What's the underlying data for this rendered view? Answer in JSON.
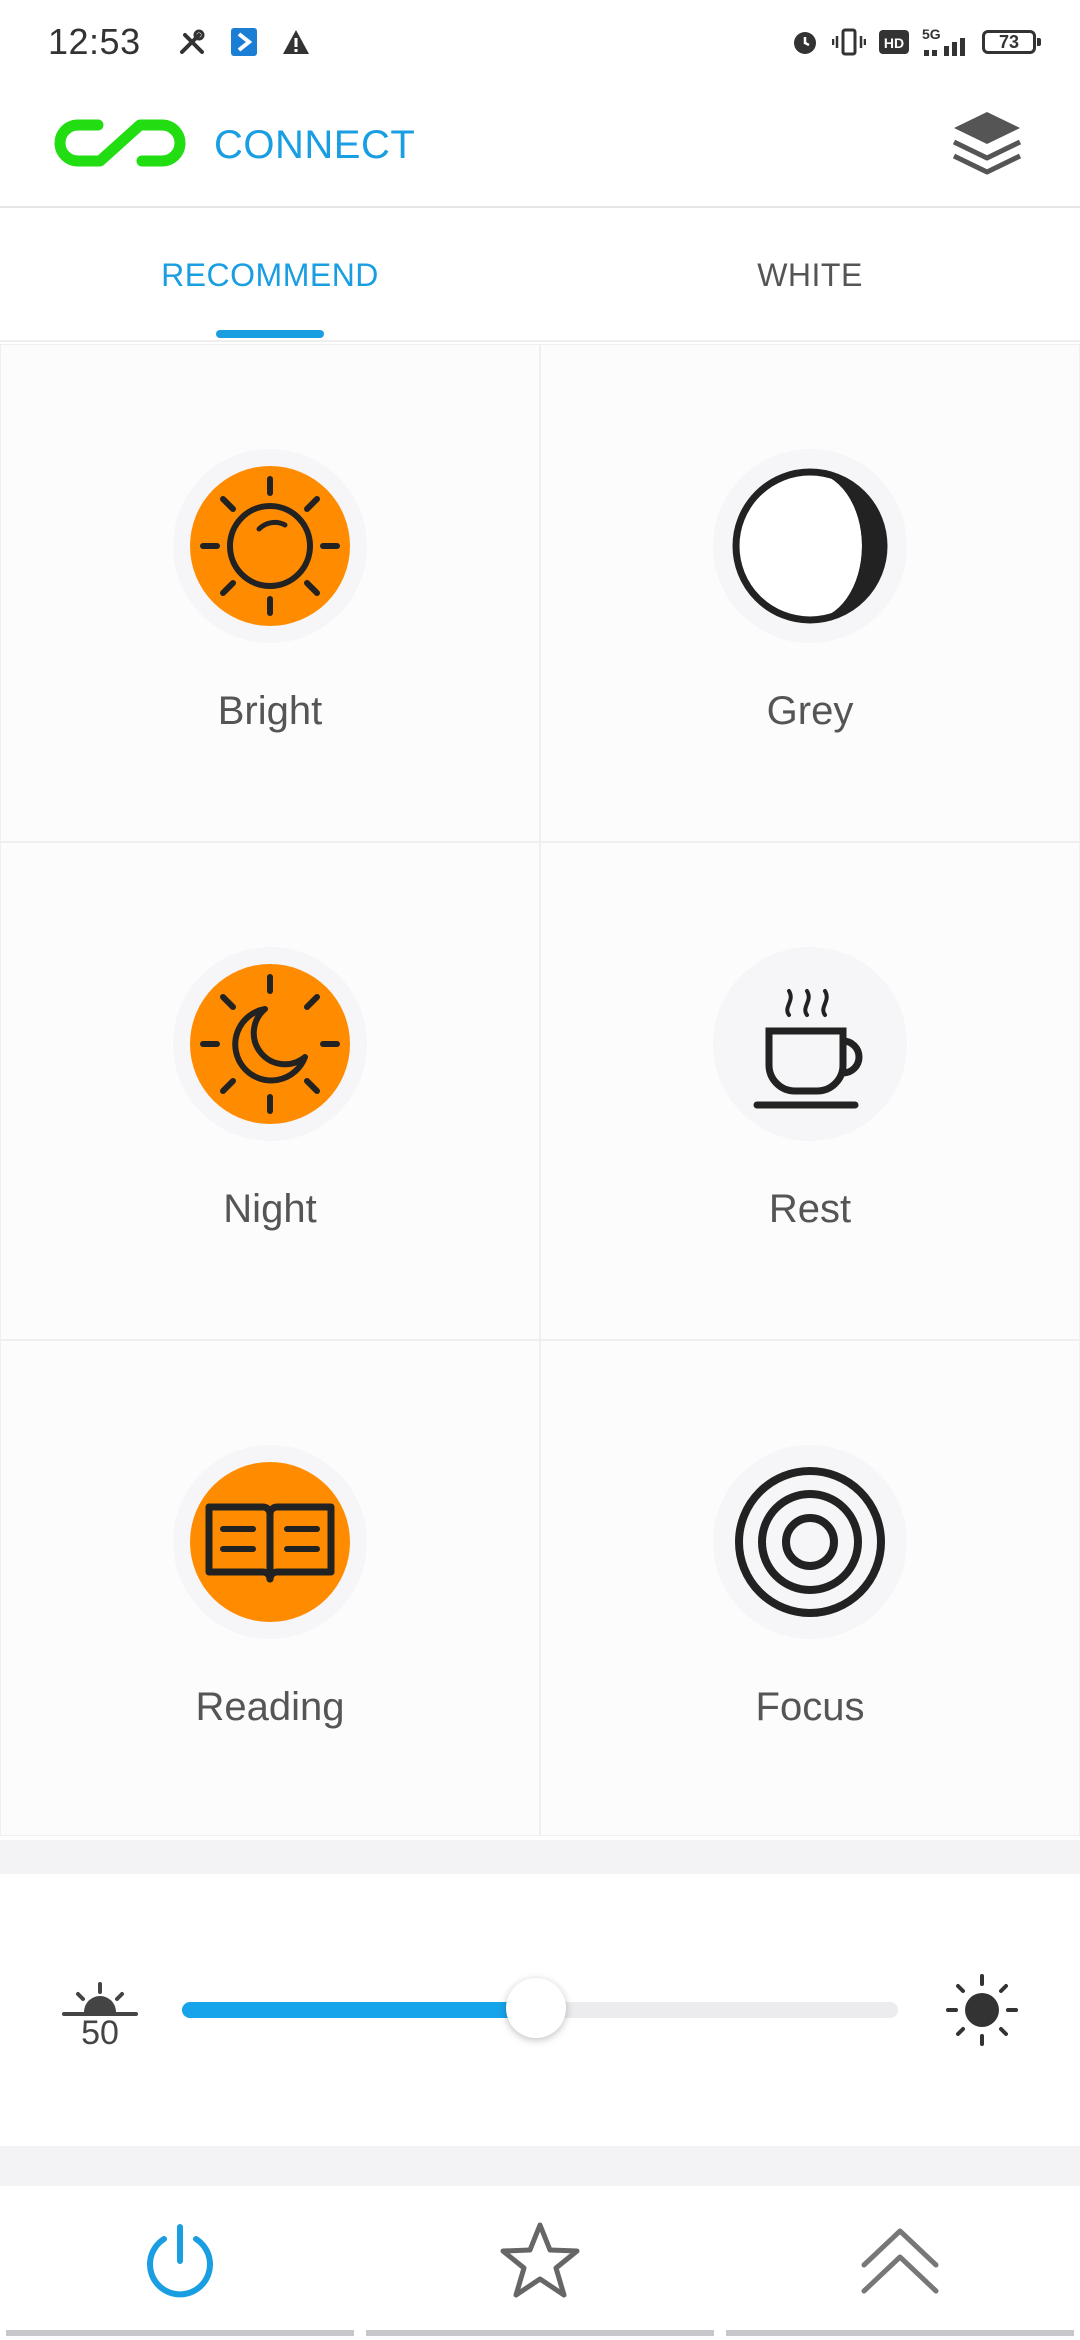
{
  "status_bar": {
    "time": "12:53",
    "battery": "73",
    "network": "5G",
    "hd": "HD"
  },
  "header": {
    "brand_label": "CONNECT",
    "brand_icon": "link-icon",
    "menu_icon": "layers-icon"
  },
  "tabs": [
    {
      "label": "RECOMMEND",
      "active": true
    },
    {
      "label": "WHITE",
      "active": false
    }
  ],
  "modes": [
    {
      "label": "Bright",
      "icon": "sun-icon"
    },
    {
      "label": "Grey",
      "icon": "half-moon-icon"
    },
    {
      "label": "Night",
      "icon": "moon-sun-icon"
    },
    {
      "label": "Rest",
      "icon": "coffee-cup-icon"
    },
    {
      "label": "Reading",
      "icon": "book-icon"
    },
    {
      "label": "Focus",
      "icon": "target-icon"
    }
  ],
  "brightness": {
    "value": "50",
    "fraction": 0.5
  },
  "bottom_nav": [
    {
      "name": "power",
      "icon": "power-icon",
      "active": true
    },
    {
      "name": "favorites",
      "icon": "star-icon",
      "active": false
    },
    {
      "name": "expand",
      "icon": "double-chevron-up-icon",
      "active": false
    }
  ],
  "colors": {
    "accent": "#1a9ee2",
    "orange": "#ff8c00",
    "brand_green": "#22dd11"
  }
}
